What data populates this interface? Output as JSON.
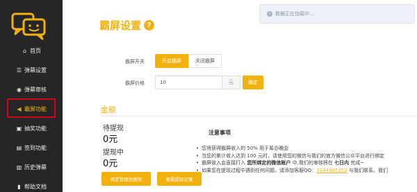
{
  "sidebar": {
    "items": [
      {
        "label": "首页",
        "icon": "home-icon",
        "glyph": "⌂"
      },
      {
        "label": "弹幕设置",
        "icon": "sliders-icon",
        "glyph": "☰"
      },
      {
        "label": "弹幕审核",
        "icon": "eye-icon",
        "glyph": "◉"
      },
      {
        "label": "霸屏功能",
        "icon": "megaphone-icon",
        "glyph": "◀"
      },
      {
        "label": "抽奖功能",
        "icon": "video-icon",
        "glyph": "▣"
      },
      {
        "label": "签到功能",
        "icon": "id-card-icon",
        "glyph": "▤"
      },
      {
        "label": "历史弹幕",
        "icon": "folder-icon",
        "glyph": "▥"
      },
      {
        "label": "帮助文档",
        "icon": "book-icon",
        "glyph": "▮"
      }
    ],
    "active_index": 3
  },
  "toast": {
    "text": "数据正在加载中..."
  },
  "page": {
    "title": "霸屏设置"
  },
  "form": {
    "switch_label": "霸屏开关",
    "on_label": "开启霸屏",
    "off_label": "关闭霸屏",
    "price_label": "霸屏价格",
    "price_value": "10",
    "unit": "元",
    "confirm_label": "确定"
  },
  "balance": {
    "section_title": "金额",
    "pending_label": "待提现",
    "pending_value": "0元",
    "withdrawing_label": "提现中",
    "withdrawing_value": "0元",
    "bind_button": "绑定管理员微信",
    "records_button": "查看提现记录"
  },
  "notice": {
    "title": "注意事项",
    "items": [
      {
        "text": "您将获得霸屏收入的 50% 用于筹办晚会"
      },
      {
        "text": "当您的累计收入达到 100 元时，请使用您的微信与我们的官方微信公众平台进行绑定"
      },
      {
        "pre": "霸屏收入会直接打入 ",
        "bold1": "您所绑定的微信账户",
        "mid": " 中,我们的审核将在 ",
        "bold2": "七日内",
        "post": " 完成~"
      },
      {
        "pre": "如果您在提现过程中遇到任何问题，请添加客服QQ：",
        "qq": "3144405352",
        "post": " 与我们联系。我们"
      }
    ]
  },
  "colors": {
    "accent": "#f3b10f",
    "sidebar_bg": "#262626",
    "highlight_border": "#d9001b"
  }
}
